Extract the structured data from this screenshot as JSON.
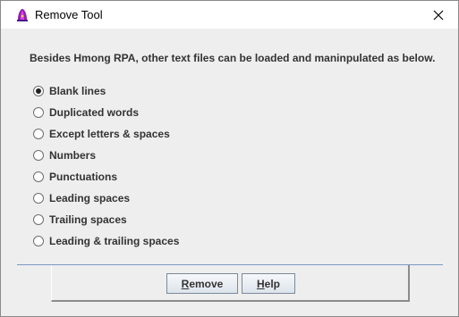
{
  "window": {
    "title": "Remove Tool",
    "icon": "purple-hat-app-icon",
    "close_icon": "close-icon"
  },
  "description": "Besides Hmong RPA, other text files can be loaded and maninpulated as below.",
  "options": [
    {
      "label": "Blank lines",
      "selected": true
    },
    {
      "label": "Duplicated words",
      "selected": false
    },
    {
      "label": "Except letters & spaces",
      "selected": false
    },
    {
      "label": "Numbers",
      "selected": false
    },
    {
      "label": "Punctuations",
      "selected": false
    },
    {
      "label": "Leading spaces",
      "selected": false
    },
    {
      "label": "Trailing spaces",
      "selected": false
    },
    {
      "label": "Leading & trailing spaces",
      "selected": false
    }
  ],
  "buttons": {
    "remove": {
      "mnemonic": "R",
      "rest": "emove"
    },
    "help": {
      "mnemonic": "H",
      "rest": "elp"
    }
  },
  "colors": {
    "separator": "#7a99c4",
    "icon_purple": "#7b1fa2"
  }
}
